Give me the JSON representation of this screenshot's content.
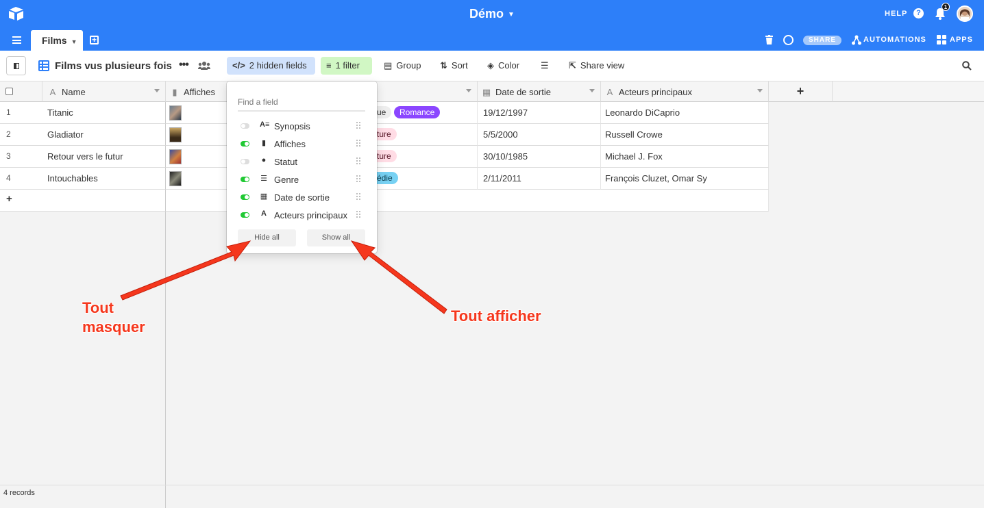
{
  "app": {
    "base_name": "Démo",
    "help_label": "HELP",
    "notification_count": "1"
  },
  "tabs": [
    {
      "label": "Films"
    }
  ],
  "topright": {
    "share_label": "SHARE",
    "automations_label": "AUTOMATIONS",
    "apps_label": "APPS"
  },
  "viewbar": {
    "view_name": "Films vus plusieurs fois",
    "hidden_fields_label": "2 hidden fields",
    "filter_label": "1 filter",
    "group_label": "Group",
    "sort_label": "Sort",
    "color_label": "Color",
    "share_view_label": "Share view"
  },
  "columns": [
    {
      "label": "Name"
    },
    {
      "label": "Affiches"
    },
    {
      "label": "Date de sortie"
    },
    {
      "label": "Acteurs principaux"
    }
  ],
  "rows": [
    {
      "num": "1",
      "name": "Titanic",
      "genre_partial": "ue",
      "genre_tag": "Romance",
      "date": "19/12/1997",
      "actors": "Leonardo DiCaprio"
    },
    {
      "num": "2",
      "name": "Gladiator",
      "genre_partial": "ture",
      "genre_tag": "",
      "date": "5/5/2000",
      "actors": "Russell Crowe"
    },
    {
      "num": "3",
      "name": "Retour vers le futur",
      "genre_partial": "ture",
      "genre_tag": "",
      "date": "30/10/1985",
      "actors": "Michael J. Fox"
    },
    {
      "num": "4",
      "name": "Intouchables",
      "genre_partial": "édie",
      "genre_tag": "",
      "date": "2/11/2011",
      "actors": "François Cluzet, Omar Sy"
    }
  ],
  "footer": {
    "record_count": "4 records"
  },
  "hidden_fields_popover": {
    "search_placeholder": "Find a field",
    "fields": [
      {
        "label": "Synopsis",
        "visible": false,
        "icon": "long-text-icon"
      },
      {
        "label": "Affiches",
        "visible": true,
        "icon": "attachment-icon"
      },
      {
        "label": "Statut",
        "visible": false,
        "icon": "single-select-icon"
      },
      {
        "label": "Genre",
        "visible": true,
        "icon": "multi-select-icon"
      },
      {
        "label": "Date de sortie",
        "visible": true,
        "icon": "calendar-icon"
      },
      {
        "label": "Acteurs principaux",
        "visible": true,
        "icon": "text-icon"
      }
    ],
    "hide_all_label": "Hide all",
    "show_all_label": "Show all"
  },
  "annotations": {
    "left_line1": "Tout",
    "left_line2": "masquer",
    "right": "Tout afficher"
  },
  "colors": {
    "brand": "#2d7ff9",
    "annotation": "#f5371d",
    "toggle_on": "#20c933"
  }
}
